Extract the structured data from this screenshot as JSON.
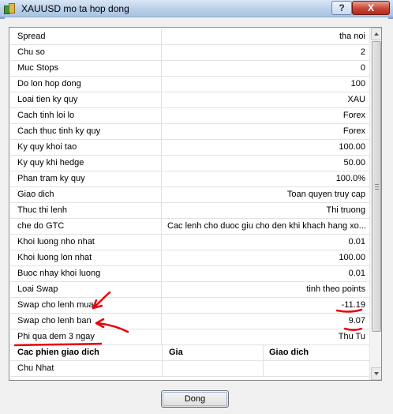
{
  "window": {
    "title": "XAUUSD mo ta hop dong",
    "help_label": "?",
    "close_label": "X"
  },
  "properties": [
    {
      "key": "Spread",
      "value": "tha noi",
      "align": "right"
    },
    {
      "key": "Chu so",
      "value": "2",
      "align": "right"
    },
    {
      "key": "Muc Stops",
      "value": "0",
      "align": "right"
    },
    {
      "key": "Do lon hop dong",
      "value": "100",
      "align": "right"
    },
    {
      "key": "Loai tien ky quy",
      "value": "XAU",
      "align": "right"
    },
    {
      "key": "Cach tinh loi lo",
      "value": "Forex",
      "align": "right"
    },
    {
      "key": "Cach thuc tinh ky quy",
      "value": "Forex",
      "align": "right"
    },
    {
      "key": "Ky quy khoi tao",
      "value": "100.00",
      "align": "right"
    },
    {
      "key": "Ky quy khi hedge",
      "value": "50.00",
      "align": "right"
    },
    {
      "key": "Phan tram ky quy",
      "value": "100.0%",
      "align": "right"
    },
    {
      "key": "Giao dich",
      "value": "Toan quyen truy cap",
      "align": "right"
    },
    {
      "key": "Thuc thi lenh",
      "value": "Thi truong",
      "align": "right"
    },
    {
      "key": "che do GTC",
      "value": "Cac lenh cho duoc giu cho den khi khach hang xo...",
      "align": "left"
    },
    {
      "key": "Khoi luong nho nhat",
      "value": "0.01",
      "align": "right"
    },
    {
      "key": "Khoi luong lon nhat",
      "value": "100.00",
      "align": "right"
    },
    {
      "key": "Buoc nhay khoi luong",
      "value": "0.01",
      "align": "right"
    },
    {
      "key": "Loai Swap",
      "value": "tinh theo points",
      "align": "right"
    },
    {
      "key": "Swap cho lenh mua",
      "value": "-11.19",
      "align": "right"
    },
    {
      "key": "Swap cho lenh ban",
      "value": "9.07",
      "align": "right"
    },
    {
      "key": "Phi qua dem 3 ngay",
      "value": "Thu Tu",
      "align": "right"
    }
  ],
  "sessions": {
    "headers": [
      "Cac phien giao dich",
      "Gia",
      "Giao dich"
    ],
    "rows": [
      "Chu Nhat"
    ]
  },
  "buttons": {
    "close_label": "Dong"
  },
  "colors": {
    "annotation": "#e8000a",
    "titlebar": "#b9d0ea"
  }
}
